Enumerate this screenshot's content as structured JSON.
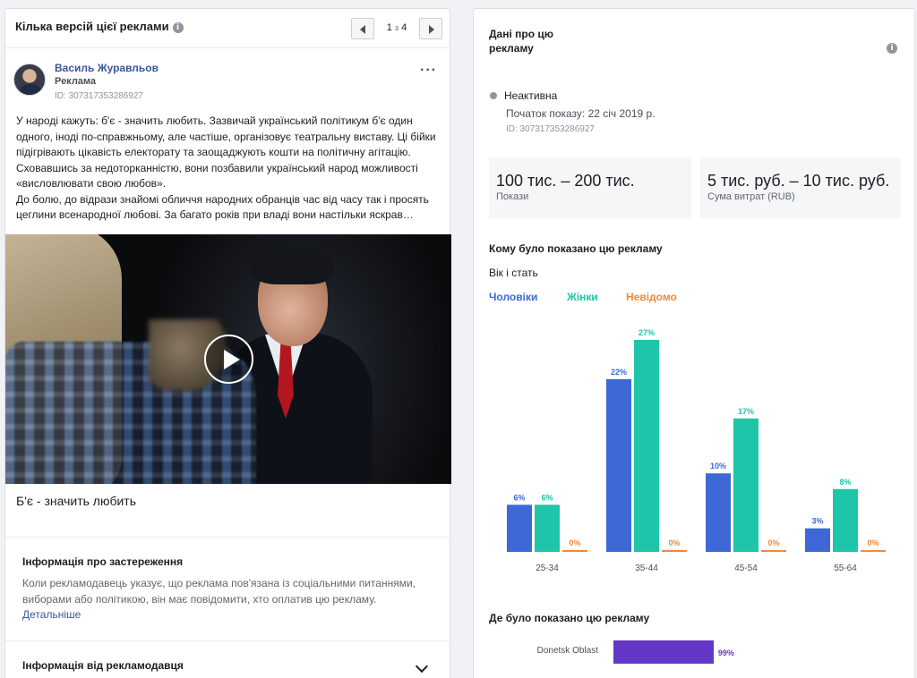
{
  "colors": {
    "men": "#3d68d6",
    "women": "#1ec5a8",
    "unknown": "#f08a3c",
    "region": "#6438c6",
    "link": "#385898"
  },
  "left": {
    "title": "Кілька версій цієї реклами",
    "pager": {
      "current": "1",
      "of": "з",
      "total": "4"
    },
    "advertiser": {
      "name": "Василь Журавльов",
      "sub": "Реклама",
      "id": "ID: 307317353286927"
    },
    "ad_text": "У народі кажуть: б'є - значить любить. Зазвичай український політикум б'є один одного, іноді по-справжньому, але частіше, організовує театральну виставу. Ці бійки підігрівають цікавість електорату та заощаджують кошти на політичну агітацію. Сховавшись за недоторканністю, вони позбавили український народ можливості «висловлювати свою любов».\nДо болю, до відрази знайомі обличчя народних обранців час від часу так і просять цеглини всенародної любові. За багато років при владі вони настільки яскрав…",
    "video_caption": "Б'є - значить любить",
    "disclaimer": {
      "title": "Інформація про застереження",
      "text": "Коли рекламодавець указує, що реклама пов'язана із соціальними питаннями, виборами або політикою, він має повідомити, хто оплатив цю рекламу.",
      "link": "Детальніше"
    },
    "advertiser_info_title": "Інформація від рекламодавця"
  },
  "right": {
    "title": "Дані про цю рекламу",
    "status": "Неактивна",
    "start": "Початок показу: 22 січ 2019 р.",
    "id": "ID: 307317353286927",
    "impressions": {
      "value": "100 тис. – 200 тис.",
      "label": "Покази"
    },
    "spend": {
      "value": "5 тис. руб. – 10 тис. руб.",
      "label": "Сума витрат (RUB)"
    },
    "who_title": "Кому було показано цю рекламу",
    "age_gender_title": "Вік і стать",
    "legend": {
      "men": "Чоловіки",
      "women": "Жінки",
      "unknown": "Невідомо"
    },
    "where_title": "Де було показано цю рекламу"
  },
  "chart_data": [
    {
      "type": "bar",
      "categories": [
        "25-34",
        "35-44",
        "45-54",
        "55-64"
      ],
      "series": [
        {
          "name": "Чоловіки",
          "values": [
            6,
            22,
            10,
            3
          ]
        },
        {
          "name": "Жінки",
          "values": [
            6,
            27,
            17,
            8
          ]
        },
        {
          "name": "Невідомо",
          "values": [
            0,
            0,
            0,
            0
          ]
        }
      ],
      "value_suffix": "%",
      "ylim": [
        0,
        27
      ]
    },
    {
      "type": "bar",
      "orientation": "horizontal",
      "categories": [
        "Donetsk Oblast"
      ],
      "values": [
        99
      ],
      "value_suffix": "%",
      "xlim": [
        0,
        100
      ]
    }
  ]
}
